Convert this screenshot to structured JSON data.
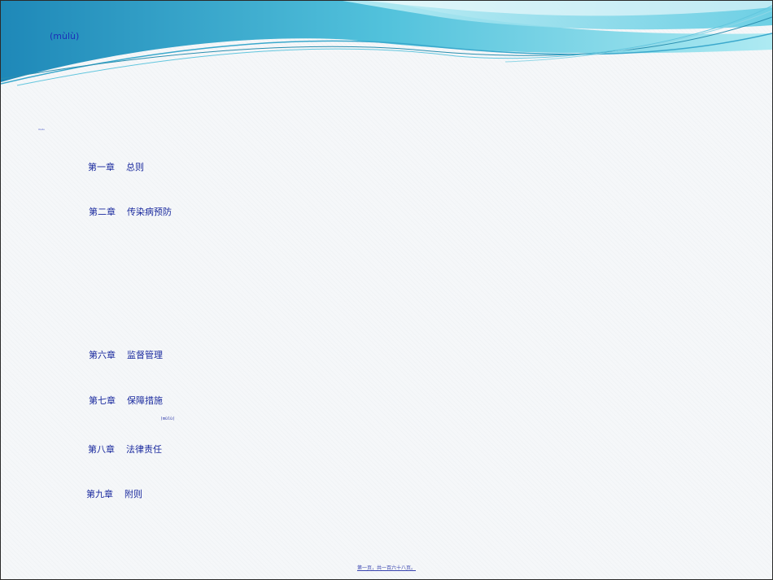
{
  "header": {
    "title": "(mùlù)",
    "tiny_mark": "mulu"
  },
  "toc": {
    "items": [
      {
        "label": "第一章    总则"
      },
      {
        "label": "第二章    传染病预防"
      },
      {
        "label": "第六章    监督管理"
      },
      {
        "label": "第七章    保障措施"
      },
      {
        "label": "第八章    法律责任"
      },
      {
        "label": "第九章    附则"
      }
    ],
    "ruby_mark": "(mùlù)"
  },
  "footer": {
    "page_text": "第一页，共一百六十八页。"
  },
  "colors": {
    "text_blue": "#1a2a9e",
    "wave_light": "#a8e6f0",
    "wave_mid": "#5cc8e0",
    "wave_dark": "#1e88b8"
  }
}
